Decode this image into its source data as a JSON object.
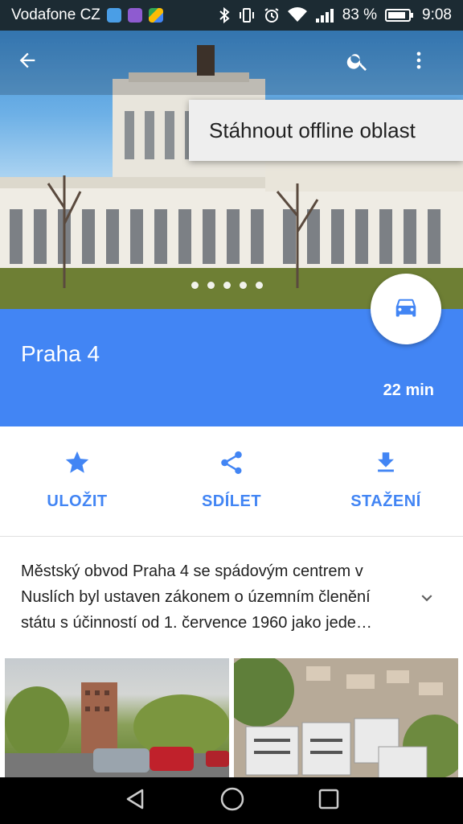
{
  "status_bar": {
    "carrier": "Vodafone CZ",
    "battery": "83 %",
    "time": "9:08"
  },
  "menu": {
    "download_offline": "Stáhnout offline oblast"
  },
  "place": {
    "title": "Praha 4",
    "eta": "22 min",
    "description": "Městský obvod Praha 4 se spádovým centrem v Nuslích byl ustaven zákonem o územním členění státu s účinností od 1. července 1960 jako jede…"
  },
  "actions": [
    {
      "label": "ULOŽIT",
      "icon": "star-icon"
    },
    {
      "label": "SDÍLET",
      "icon": "share-icon"
    },
    {
      "label": "STAŽENÍ",
      "icon": "download-icon"
    }
  ],
  "colors": {
    "accent": "#4285f4",
    "status_bar": "#1c2b33"
  }
}
